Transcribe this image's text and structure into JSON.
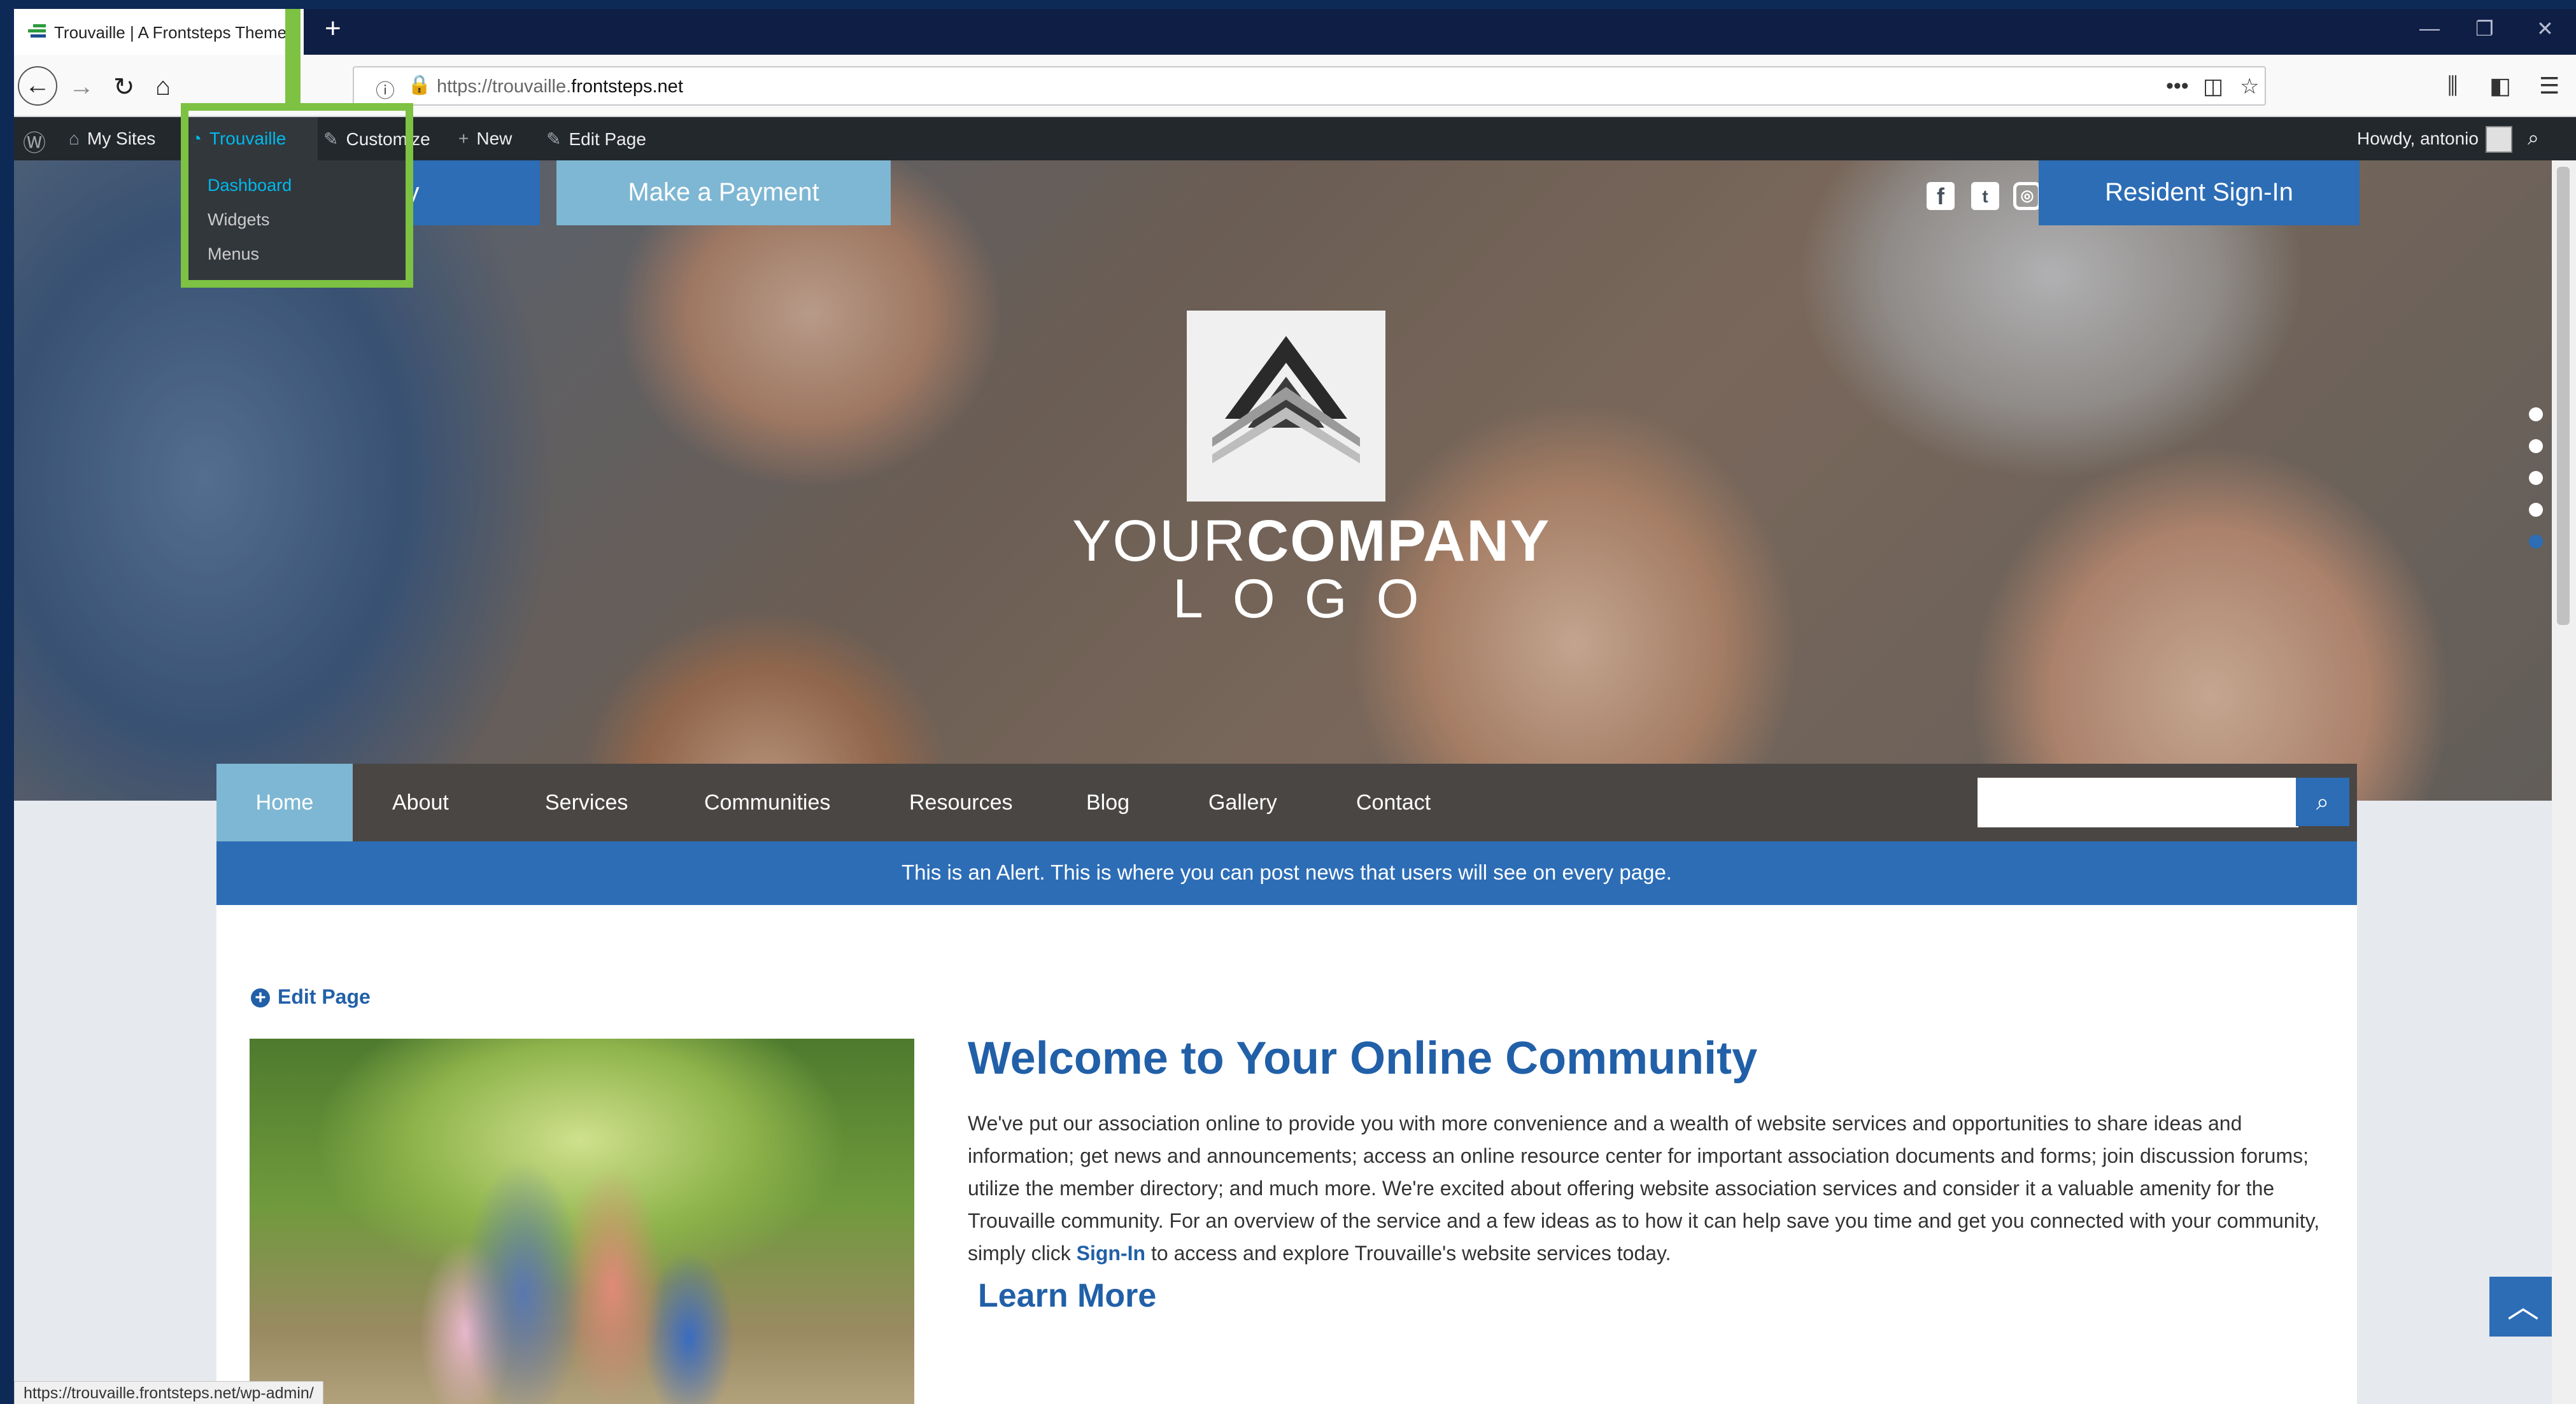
{
  "browser": {
    "tab_title": "Trouvaille | A Frontsteps Theme",
    "url_prefix": "https://trouvaille.",
    "url_domain": "frontsteps.net",
    "status_url": "https://trouvaille.frontsteps.net/wp-admin/"
  },
  "adminbar": {
    "my_sites": "My Sites",
    "site_name": "Trouvaille",
    "customize": "Customize",
    "new": "New",
    "edit_page": "Edit Page",
    "greeting": "Howdy, antonio",
    "dropdown": [
      "Dashboard",
      "Widgets",
      "Menus"
    ]
  },
  "hero": {
    "community_button": "unity",
    "payment_button": "Make a Payment",
    "signin_button": "Resident Sign-In",
    "logo_line1_a": "YOUR",
    "logo_line1_b": "COMPANY",
    "logo_line2": "LOGO",
    "social_icons": [
      "facebook-icon",
      "twitter-icon",
      "instagram-icon"
    ]
  },
  "mainnav": {
    "items": [
      "Home",
      "About",
      "Services",
      "Communities",
      "Resources",
      "Blog",
      "Gallery",
      "Contact"
    ],
    "active": "Home"
  },
  "alert": "This is an Alert. This is where you can post news that users will see on every page.",
  "content": {
    "edit_link": "Edit Page",
    "heading": "Welcome to Your Online Community",
    "paragraph_before_link": "We've put our association online to provide you with more convenience and a wealth of website services and opportunities to share ideas and information; get news and announcements; access an online resource center for important association documents and forms; join discussion forums; utilize the member directory; and much more. We're excited about offering website association services and consider it a valuable amenity for the Trouvaille community. For an overview of the service and a few ideas as to how it can help save you time and get you connected with your community, simply click ",
    "link_text": "Sign-In",
    "paragraph_after_link": " to access and explore Trouvaille's website services today.",
    "learn_more": "Learn More"
  },
  "colors": {
    "brand_blue": "#2c6db6",
    "light_blue": "#7eb7d3",
    "nav_gray": "#4a4644",
    "highlight_green": "#7dc242",
    "wp_admin_bar": "#23282d"
  }
}
